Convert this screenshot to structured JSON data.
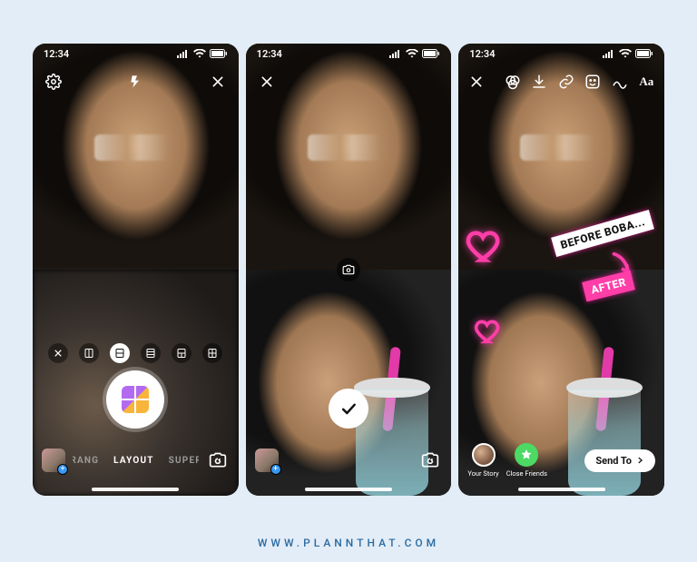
{
  "status": {
    "time": "12:34"
  },
  "phone1": {
    "modes": {
      "prev": "OMERANG",
      "active": "LAYOUT",
      "next": "SUPERZOO"
    }
  },
  "phone3": {
    "sticker_before": "BEFORE BOBA...",
    "sticker_after": "AFTER",
    "share": {
      "your_story": "Your Story",
      "close_friends": "Close Friends",
      "send_to": "Send To"
    }
  },
  "footer": {
    "credit": "WWW.PLANNTHAT.COM"
  }
}
